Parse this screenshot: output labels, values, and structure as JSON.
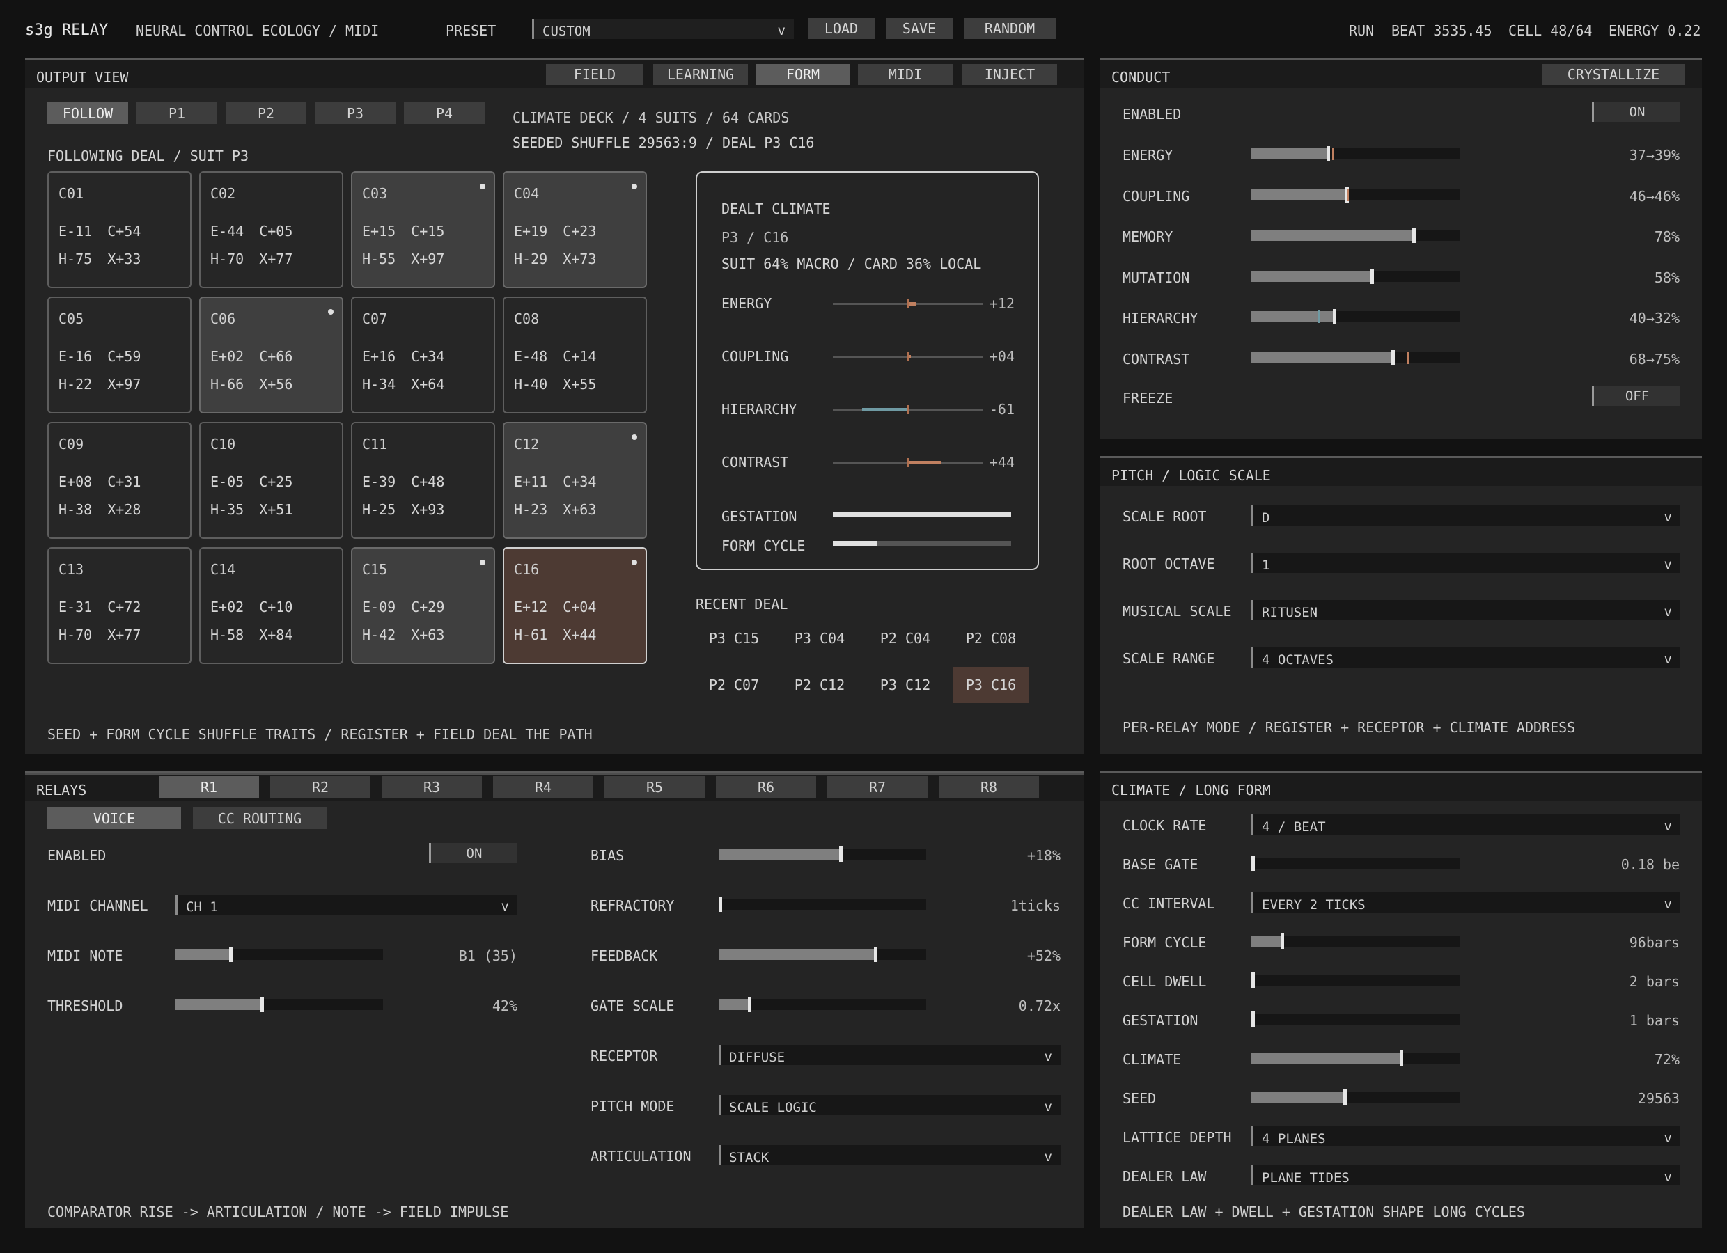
{
  "topbar": {
    "app": "s3g RELAY",
    "subtitle": "NEURAL CONTROL ECOLOGY / MIDI",
    "preset_label": "PRESET",
    "preset_value": "CUSTOM",
    "load": "LOAD",
    "save": "SAVE",
    "random": "RANDOM",
    "status_run": "RUN",
    "status_beat": "BEAT 3535.45",
    "status_cell": "CELL 48/64",
    "status_energy": "ENERGY 0.22"
  },
  "output": {
    "title": "OUTPUT VIEW",
    "tabs": [
      "FIELD",
      "LEARNING",
      "FORM",
      "MIDI",
      "INJECT"
    ],
    "active_tab": "FORM",
    "suits": [
      "FOLLOW",
      "P1",
      "P2",
      "P3",
      "P4"
    ],
    "deck_line1": "CLIMATE DECK / 4 SUITS / 64 CARDS",
    "deck_line2": "SEEDED SHUFFLE 29563:9 / DEAL P3 C16",
    "following": "FOLLOWING DEAL / SUIT P3",
    "cards": [
      {
        "id": "C01",
        "l1": "E-11 C+54",
        "l2": "H-75 X+33",
        "state": "normal"
      },
      {
        "id": "C02",
        "l1": "E-44 C+05",
        "l2": "H-70 X+77",
        "state": "normal"
      },
      {
        "id": "C03",
        "l1": "E+15 C+15",
        "l2": "H-55 X+97",
        "state": "hl"
      },
      {
        "id": "C04",
        "l1": "E+19 C+23",
        "l2": "H-29 X+73",
        "state": "hl"
      },
      {
        "id": "C05",
        "l1": "E-16 C+59",
        "l2": "H-22 X+97",
        "state": "normal"
      },
      {
        "id": "C06",
        "l1": "E+02 C+66",
        "l2": "H-66 X+56",
        "state": "hl"
      },
      {
        "id": "C07",
        "l1": "E+16 C+34",
        "l2": "H-34 X+64",
        "state": "normal"
      },
      {
        "id": "C08",
        "l1": "E-48 C+14",
        "l2": "H-40 X+55",
        "state": "normal"
      },
      {
        "id": "C09",
        "l1": "E+08 C+31",
        "l2": "H-38 X+28",
        "state": "normal"
      },
      {
        "id": "C10",
        "l1": "E-05 C+25",
        "l2": "H-35 X+51",
        "state": "normal"
      },
      {
        "id": "C11",
        "l1": "E-39 C+48",
        "l2": "H-25 X+93",
        "state": "normal"
      },
      {
        "id": "C12",
        "l1": "E+11 C+34",
        "l2": "H-23 X+63",
        "state": "hl"
      },
      {
        "id": "C13",
        "l1": "E-31 C+72",
        "l2": "H-70 X+77",
        "state": "normal"
      },
      {
        "id": "C14",
        "l1": "E+02 C+10",
        "l2": "H-58 X+84",
        "state": "normal"
      },
      {
        "id": "C15",
        "l1": "E-09 C+29",
        "l2": "H-42 X+63",
        "state": "hl"
      },
      {
        "id": "C16",
        "l1": "E+12 C+04",
        "l2": "H-61 X+44",
        "state": "sel"
      }
    ],
    "dealt": {
      "title": "DEALT CLIMATE",
      "addr": "P3 / C16",
      "mix": "SUIT 64% MACRO / CARD 36% LOCAL",
      "rows": [
        {
          "label": "ENERGY",
          "value": "+12",
          "amount": 12
        },
        {
          "label": "COUPLING",
          "value": "+04",
          "amount": 4
        },
        {
          "label": "HIERARCHY",
          "value": "-61",
          "amount": -61
        },
        {
          "label": "CONTRAST",
          "value": "+44",
          "amount": 44
        }
      ],
      "gestation_label": "GESTATION",
      "gestation": 1.0,
      "form_cycle_label": "FORM CYCLE",
      "form_cycle": 0.25
    },
    "recent_title": "RECENT DEAL",
    "recent": [
      "P3 C15",
      "P3 C04",
      "P2 C04",
      "P2 C08",
      "P2 C07",
      "P2 C12",
      "P3 C12",
      "P3 C16"
    ],
    "footer": "SEED + FORM CYCLE SHUFFLE TRAITS / REGISTER + FIELD DEAL THE PATH"
  },
  "conduct": {
    "title": "CONDUCT",
    "crystallize": "CRYSTALLIZE",
    "enabled_label": "ENABLED",
    "enabled": "ON",
    "sliders": [
      {
        "label": "ENERGY",
        "value": "37→39%",
        "level": 0.37,
        "target": 0.39
      },
      {
        "label": "COUPLING",
        "value": "46→46%",
        "level": 0.46,
        "target": 0.46
      },
      {
        "label": "MEMORY",
        "value": "78%",
        "level": 0.78
      },
      {
        "label": "MUTATION",
        "value": "58%",
        "level": 0.58
      },
      {
        "label": "HIERARCHY",
        "value": "40→32%",
        "level": 0.4,
        "target": 0.32
      },
      {
        "label": "CONTRAST",
        "value": "68→75%",
        "level": 0.68,
        "target": 0.75
      }
    ],
    "freeze_label": "FREEZE",
    "freeze": "OFF"
  },
  "pitch": {
    "title": "PITCH / LOGIC SCALE",
    "rows": [
      {
        "label": "SCALE ROOT",
        "value": "D"
      },
      {
        "label": "ROOT OCTAVE",
        "value": "1"
      },
      {
        "label": "MUSICAL SCALE",
        "value": "RITUSEN"
      },
      {
        "label": "SCALE RANGE",
        "value": "4 OCTAVES"
      }
    ],
    "footer": "PER-RELAY MODE / REGISTER + RECEPTOR + CLIMATE ADDRESS"
  },
  "relays": {
    "title": "RELAYS",
    "tabs": [
      "R1",
      "R2",
      "R3",
      "R4",
      "R5",
      "R6",
      "R7",
      "R8"
    ],
    "active_tab": "R1",
    "subtabs": [
      "VOICE",
      "CC ROUTING"
    ],
    "enabled_label": "ENABLED",
    "enabled": "ON",
    "midi_channel_label": "MIDI CHANNEL",
    "midi_channel": "CH 1",
    "midi_note_label": "MIDI NOTE",
    "midi_note": "B1 (35)",
    "midi_note_level": 0.27,
    "threshold_label": "THRESHOLD",
    "threshold": "42%",
    "threshold_level": 0.42,
    "right": [
      {
        "label": "BIAS",
        "value": "+18%",
        "level": 0.59
      },
      {
        "label": "REFRACTORY",
        "value": "1ticks",
        "level": 0.01
      },
      {
        "label": "FEEDBACK",
        "value": "+52%",
        "level": 0.76
      },
      {
        "label": "GATE SCALE",
        "value": "0.72x",
        "level": 0.15
      }
    ],
    "receptor_label": "RECEPTOR",
    "receptor": "DIFFUSE",
    "pitch_mode_label": "PITCH MODE",
    "pitch_mode": "SCALE LOGIC",
    "articulation_label": "ARTICULATION",
    "articulation": "STACK",
    "footer": "COMPARATOR RISE -> ARTICULATION / NOTE -> FIELD IMPULSE"
  },
  "climate": {
    "title": "CLIMATE / LONG FORM",
    "clock_rate_label": "CLOCK RATE",
    "clock_rate": "4 / BEAT",
    "base_gate_label": "BASE GATE",
    "base_gate": "0.18 be",
    "base_gate_level": 0.0,
    "cc_interval_label": "CC INTERVAL",
    "cc_interval": "EVERY 2 TICKS",
    "form_cycle_label": "FORM CYCLE",
    "form_cycle": "96bars",
    "form_cycle_level": 0.15,
    "cell_dwell_label": "CELL DWELL",
    "cell_dwell": "2 bars",
    "cell_dwell_level": 0.0,
    "gestation_label": "GESTATION",
    "gestation": "1 bars",
    "gestation_level": 0.01,
    "climate_label": "CLIMATE",
    "climate": "72%",
    "climate_level": 0.72,
    "seed_label": "SEED",
    "seed": "29563",
    "seed_level": 0.45,
    "lattice_label": "LATTICE DEPTH",
    "lattice": "4 PLANES",
    "dealer_label": "DEALER LAW",
    "dealer": "PLANE TIDES",
    "footer": "DEALER LAW + DWELL + GESTATION SHAPE LONG CYCLES"
  }
}
